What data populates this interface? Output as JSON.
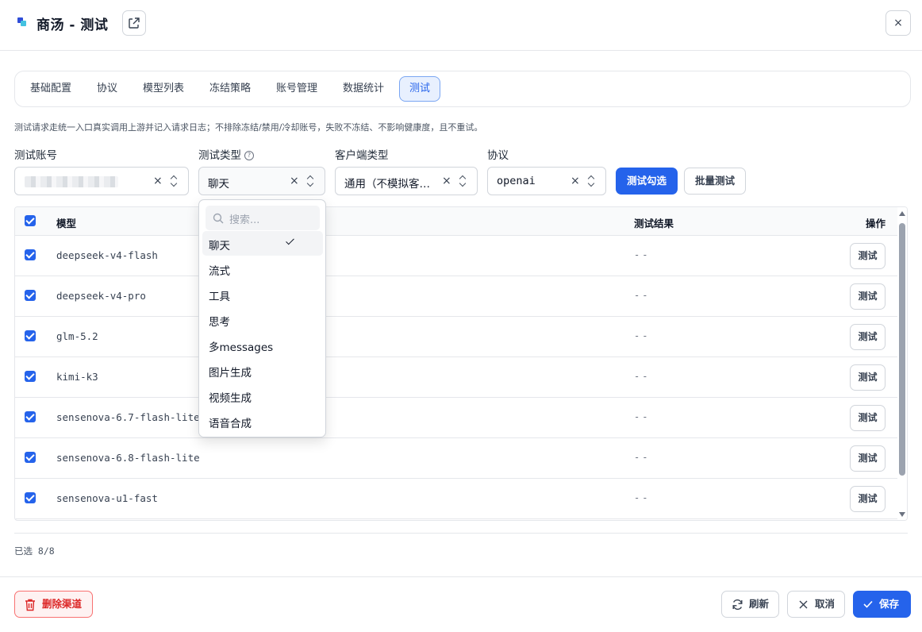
{
  "header": {
    "title": "商汤 - 测试",
    "close_symbol": "×"
  },
  "tabs": [
    {
      "label": "基础配置"
    },
    {
      "label": "协议"
    },
    {
      "label": "模型列表"
    },
    {
      "label": "冻结策略"
    },
    {
      "label": "账号管理"
    },
    {
      "label": "数据统计"
    },
    {
      "label": "测试",
      "active": true
    }
  ],
  "hint": "测试请求走统一入口真实调用上游并记入请求日志；不排除冻结/禁用/冷却账号，失败不冻结、不影响健康度，且不重试。",
  "filters": {
    "account": {
      "label": "测试账号",
      "value": ""
    },
    "test_type": {
      "label": "测试类型",
      "help": "?",
      "value": "聊天"
    },
    "client_type": {
      "label": "客户端类型",
      "value": "通用（不模拟客…"
    },
    "protocol": {
      "label": "协议",
      "value": "openai"
    },
    "clear_symbol": "×"
  },
  "actions": {
    "test_selected": "测试勾选",
    "batch_test": "批量测试"
  },
  "table": {
    "headers": {
      "model": "模型",
      "result": "测试结果",
      "action": "操作"
    },
    "rows": [
      {
        "model": "deepseek-v4-flash",
        "result": "--",
        "action": "测试",
        "checked": true
      },
      {
        "model": "deepseek-v4-pro",
        "result": "--",
        "action": "测试",
        "checked": true
      },
      {
        "model": "glm-5.2",
        "result": "--",
        "action": "测试",
        "checked": true
      },
      {
        "model": "kimi-k3",
        "result": "--",
        "action": "测试",
        "checked": true
      },
      {
        "model": "sensenova-6.7-flash-lite",
        "result": "--",
        "action": "测试",
        "checked": true
      },
      {
        "model": "sensenova-6.8-flash-lite",
        "result": "--",
        "action": "测试",
        "checked": true
      },
      {
        "model": "sensenova-u1-fast",
        "result": "--",
        "action": "测试",
        "checked": true
      }
    ]
  },
  "selection_count": "已选 8/8",
  "footer": {
    "delete": "删除渠道",
    "refresh": "刷新",
    "cancel": "取消",
    "save": "保存"
  },
  "dropdown": {
    "search_placeholder": "搜索...",
    "options": [
      {
        "label": "聊天",
        "selected": true
      },
      {
        "label": "流式"
      },
      {
        "label": "工具"
      },
      {
        "label": "思考"
      },
      {
        "label": "多messages"
      },
      {
        "label": "图片生成"
      },
      {
        "label": "视频生成"
      },
      {
        "label": "语音合成"
      }
    ]
  },
  "colors": {
    "primary": "#2563eb",
    "danger": "#dc2626",
    "border": "#d1d5db"
  }
}
